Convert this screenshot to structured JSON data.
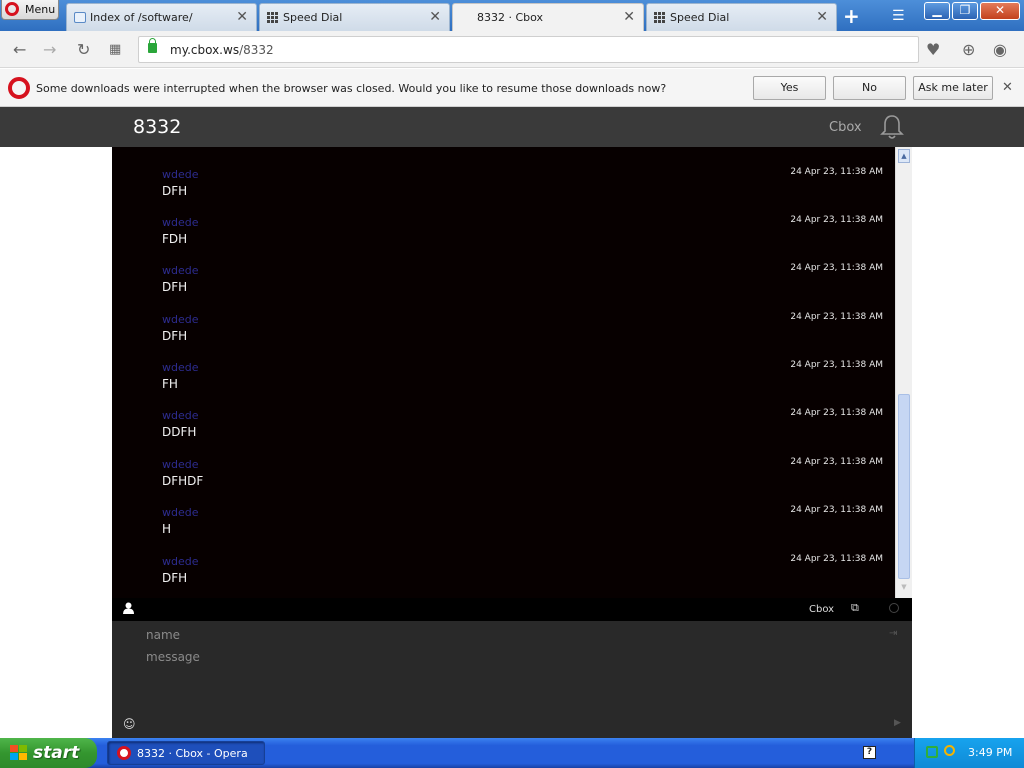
{
  "browser": {
    "menu_label": "Menu",
    "tabs": [
      {
        "title": "Index of /software/",
        "icon": "ie-page-icon"
      },
      {
        "title": "Speed Dial",
        "icon": "speed-dial-icon"
      },
      {
        "title": "8332 · Cbox",
        "icon": "none",
        "active": true
      },
      {
        "title": "Speed Dial",
        "icon": "speed-dial-icon"
      }
    ],
    "url_host": "my.cbox.ws",
    "url_path": "/8332"
  },
  "infobar": {
    "message": "Some downloads were interrupted when the browser was closed. Would you like to resume those downloads now?",
    "yes": "Yes",
    "no": "No",
    "later": "Ask me later"
  },
  "cbox": {
    "title": "8332",
    "brand": "Cbox",
    "messages": [
      {
        "author": "wdede",
        "text": "DFH",
        "time": "24 Apr 23, 11:38 AM"
      },
      {
        "author": "wdede",
        "text": "FDH",
        "time": "24 Apr 23, 11:38 AM"
      },
      {
        "author": "wdede",
        "text": "DFH",
        "time": "24 Apr 23, 11:38 AM"
      },
      {
        "author": "wdede",
        "text": "DFH",
        "time": "24 Apr 23, 11:38 AM"
      },
      {
        "author": "wdede",
        "text": "FH",
        "time": "24 Apr 23, 11:38 AM"
      },
      {
        "author": "wdede",
        "text": "DDFH",
        "time": "24 Apr 23, 11:38 AM"
      },
      {
        "author": "wdede",
        "text": "DFHDF",
        "time": "24 Apr 23, 11:38 AM"
      },
      {
        "author": "wdede",
        "text": "H",
        "time": "24 Apr 23, 11:38 AM"
      },
      {
        "author": "wdede",
        "text": "DFH",
        "time": "24 Apr 23, 11:38 AM"
      }
    ],
    "toolbar_link": "Cbox",
    "name_placeholder": "name",
    "message_placeholder": "message",
    "scroll_position": 0.9
  },
  "taskbar": {
    "start_label": "start",
    "task_label": "8332 · Cbox - Opera",
    "clock": "3:49 PM"
  },
  "colors": {
    "chat_bg": "#070000",
    "author": "#2d2c8f",
    "header_bg": "#3a3a3a",
    "taskbar": "#245edb",
    "start": "#34962f"
  }
}
